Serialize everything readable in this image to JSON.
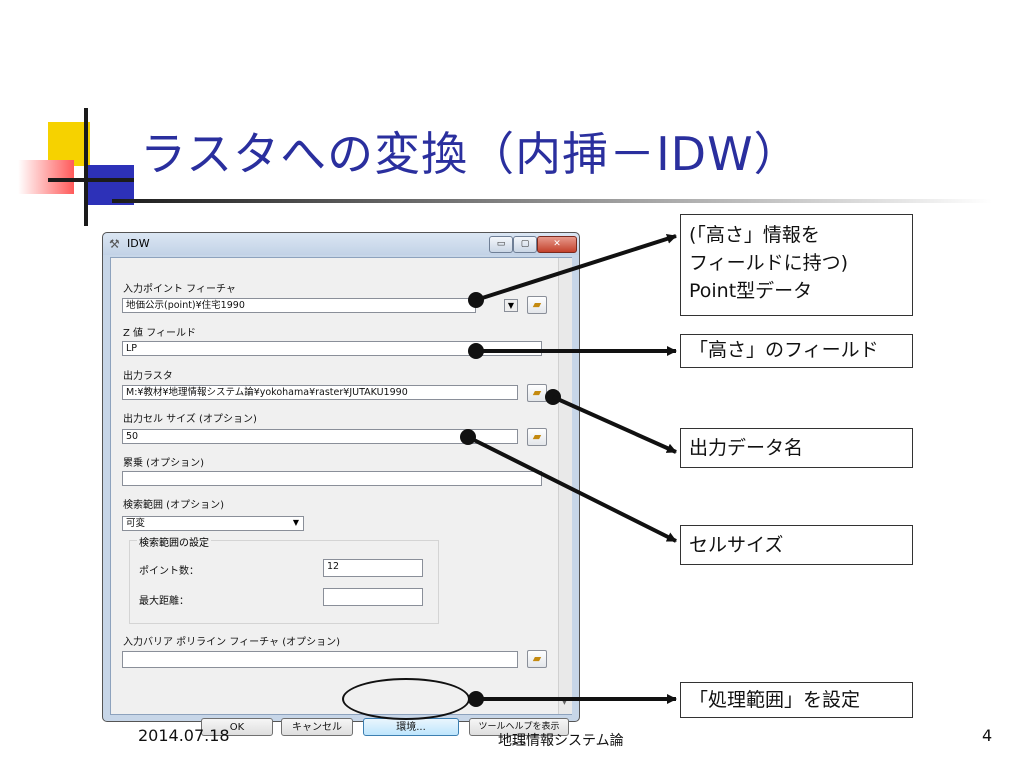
{
  "slide": {
    "title": "ラスタへの変換（内挿－IDW）",
    "footer_date": "2014.07.18",
    "footer_course": "地理情報システム論",
    "page_number": "4",
    "accent_color": "#2a2f9e"
  },
  "dialog": {
    "title": "IDW",
    "window_buttons": {
      "minimize": "▭",
      "maximize": "▢",
      "close": "✕"
    },
    "input_point_label": "入力ポイント フィーチャ",
    "input_point_value": "地価公示(point)¥住宅1990",
    "z_field_label": "Z 値 フィールド",
    "z_field_value": "LP",
    "output_raster_label": "出力ラスタ",
    "output_raster_value": "M:¥教材¥地理情報システム論¥yokohama¥raster¥JUTAKU1990",
    "cell_size_label": "出力セル サイズ (オプション)",
    "cell_size_value": "50",
    "power_label": "累乗 (オプション)",
    "power_value": "",
    "search_radius_label": "検索範囲 (オプション)",
    "search_radius_value": "可変",
    "search_settings_label": "検索範囲の設定",
    "point_count_label": "ポイント数：",
    "point_count_value": "12",
    "max_distance_label": "最大距離：",
    "max_distance_value": "",
    "barrier_label": "入力バリア ポリライン フィーチャ (オプション)",
    "barrier_value": "",
    "ok_button": "OK",
    "cancel_button": "キャンセル",
    "env_button": "環境...",
    "help_button": "ツールヘルプを表示 >>"
  },
  "callouts": {
    "height_info": [
      "(「高さ」情報を",
      "フィールドに持つ)",
      "Point型データ"
    ],
    "height_field": "「高さ」のフィールド",
    "output_name": "出力データ名",
    "cell_size": "セルサイズ",
    "processing_extent": "「処理範囲」を設定"
  }
}
